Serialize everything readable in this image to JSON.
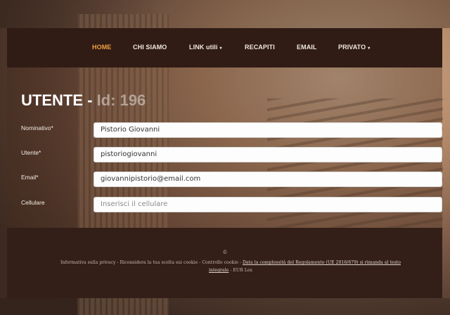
{
  "nav": {
    "home": "HOME",
    "chi_siamo": "CHI SIAMO",
    "link_utili": "LINK utili",
    "recapiti": "RECAPITI",
    "email": "EMAIL",
    "privato": "PRIVATO",
    "caret": "▾",
    "active_color": "#f0a040"
  },
  "page": {
    "title_main": "UTENTE - ",
    "title_id": "Id: 196"
  },
  "form": {
    "nominativo_label": "Nominativo*",
    "nominativo_value": "Pistorio Giovanni",
    "utente_label": "Utente*",
    "utente_value": "pistoriogiovanni",
    "email_label": "Email*",
    "email_value": "giovannipistorio@email.com",
    "cellulare_label": "Cellulare",
    "cellulare_placeholder": "Inserisci il cellulare"
  },
  "footer": {
    "copyright": "©",
    "privacy": "Informativa sulla privacy",
    "sep": " - ",
    "reconsider": "Riconsidera la tua scelta sui cookie",
    "cookie_control": "Controllo cookie",
    "regulation_link": "Data la complessità del Regolamento (UE 2016/679) si rimanda al testo",
    "integral_link": "integrale",
    "eurlex": "EUR Lex"
  }
}
